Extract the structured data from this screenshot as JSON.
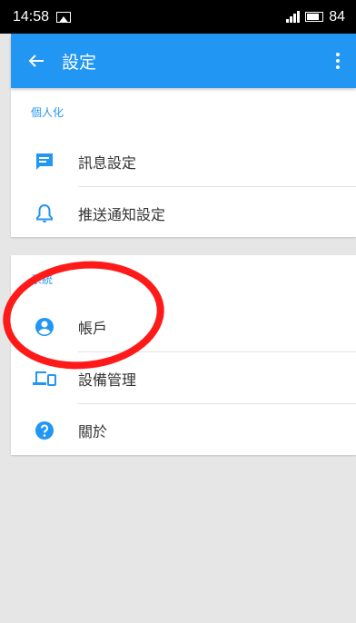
{
  "status_bar": {
    "time": "14:58",
    "battery": "84"
  },
  "app_bar": {
    "back_icon": "arrow-left-icon",
    "title": "設定",
    "more_icon": "more-vert-icon"
  },
  "sections": [
    {
      "header": "個人化",
      "items": [
        {
          "label": "訊息設定",
          "icon": "message-icon"
        },
        {
          "label": "推送通知設定",
          "icon": "bell-icon"
        }
      ]
    },
    {
      "header": "系統",
      "items": [
        {
          "label": "帳戶",
          "icon": "account-icon"
        },
        {
          "label": "設備管理",
          "icon": "devices-icon"
        },
        {
          "label": "關於",
          "icon": "help-icon"
        }
      ]
    }
  ],
  "colors": {
    "primary": "#2196f3",
    "annotation": "#ff1a1a"
  }
}
